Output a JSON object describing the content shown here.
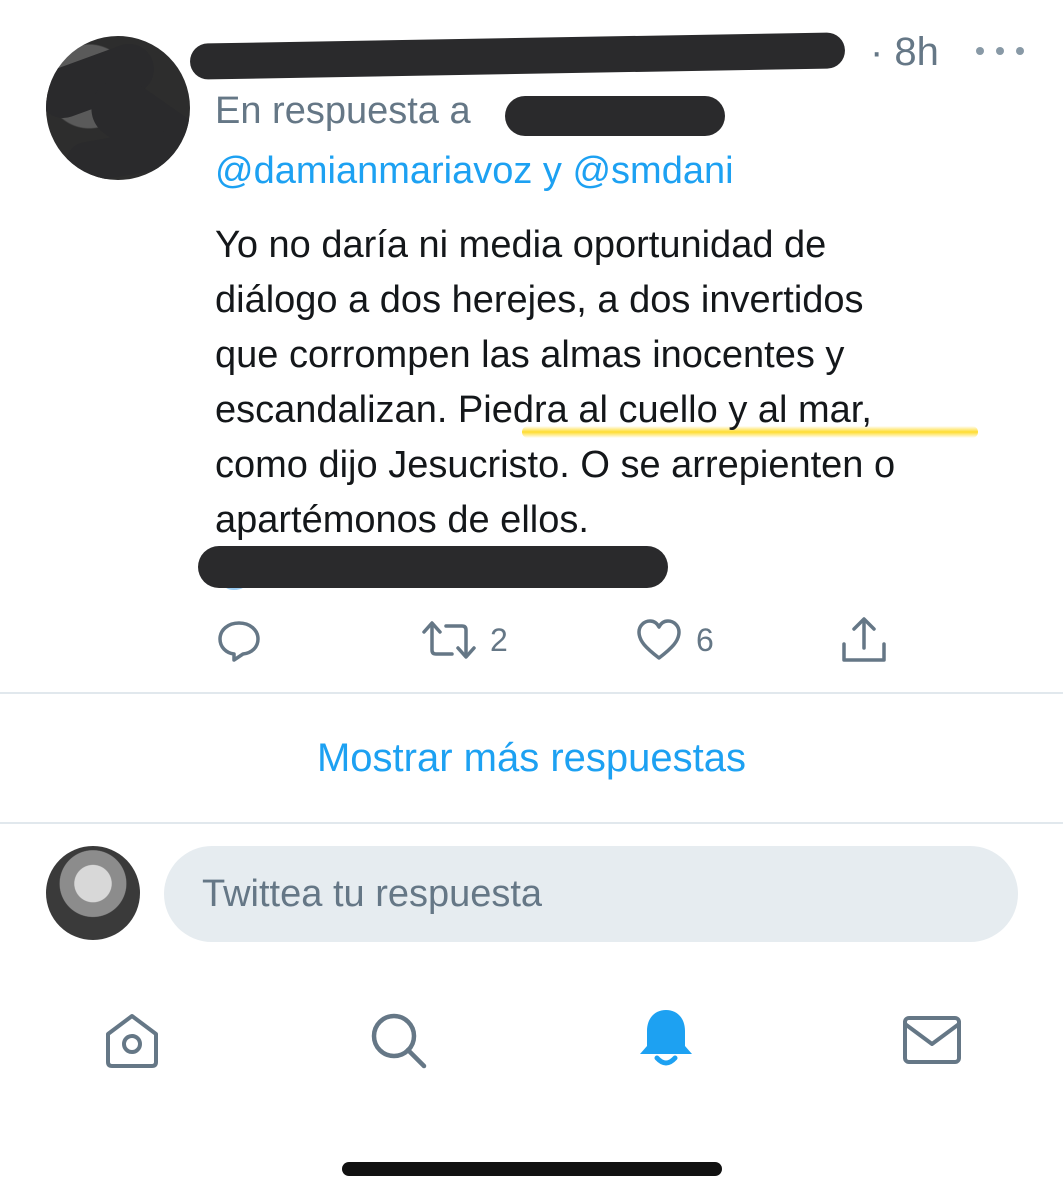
{
  "tweet": {
    "time": "· 8h",
    "reply_prefix": "En respuesta a",
    "reply_mentions": "@damianmariavoz y @smdani",
    "text": "Yo no daría ni media oportunidad de\ndiálogo a dos herejes, a dos invertidos\nque corrompen las almas inocentes y\nescandalizan. Piedra al cuello y al mar,\ncomo dijo Jesucristo. O se arrepienten o\napartémonos de ellos.",
    "link_fragment": "@",
    "retweet_count": "2",
    "like_count": "6",
    "icons": [
      "reply-icon",
      "retweet-icon",
      "like-icon",
      "share-icon",
      "more-icon"
    ]
  },
  "thread": {
    "show_more_label": "Mostrar más respuestas"
  },
  "composer": {
    "placeholder": "Twittea tu respuesta"
  },
  "nav": {
    "items": [
      {
        "icon": "home-icon",
        "active": false
      },
      {
        "icon": "search-icon",
        "active": false
      },
      {
        "icon": "bell-icon",
        "active": true
      },
      {
        "icon": "mail-icon",
        "active": false
      }
    ]
  },
  "colors": {
    "accent": "#1da1f2",
    "secondary_text": "#657786",
    "primary_text": "#14171a",
    "highlight": "#ffd60a",
    "redaction": "#2a2a2c"
  }
}
